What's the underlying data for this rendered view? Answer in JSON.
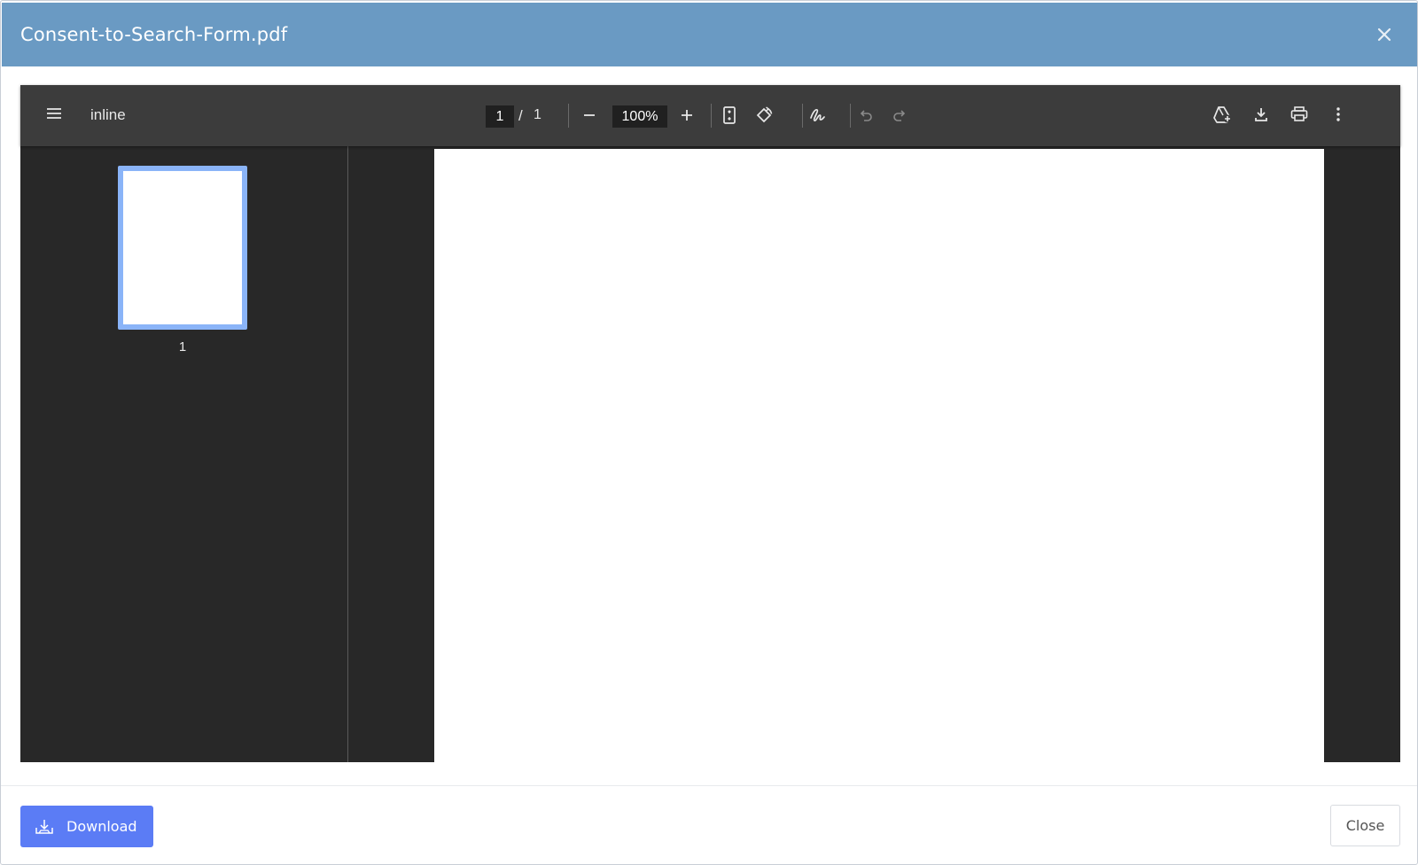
{
  "modal": {
    "title": "Consent-to-Search-Form.pdf",
    "header_color": "#6a9ac3"
  },
  "viewer": {
    "document_title": "inline",
    "current_page": "1",
    "page_separator": "/",
    "total_pages": "1",
    "zoom": "100%",
    "thumbnail_page_label": "1",
    "icons": [
      "menu-icon",
      "zoom-out-icon",
      "zoom-in-icon",
      "fit-page-icon",
      "rotate-icon",
      "annotate-icon",
      "undo-icon",
      "redo-icon",
      "save-to-drive-icon",
      "download-icon",
      "print-icon",
      "more-options-icon"
    ],
    "accent_color": "#8ab4f8"
  },
  "footer": {
    "download_label": "Download",
    "close_label": "Close",
    "download_color": "#5b7cf5"
  }
}
